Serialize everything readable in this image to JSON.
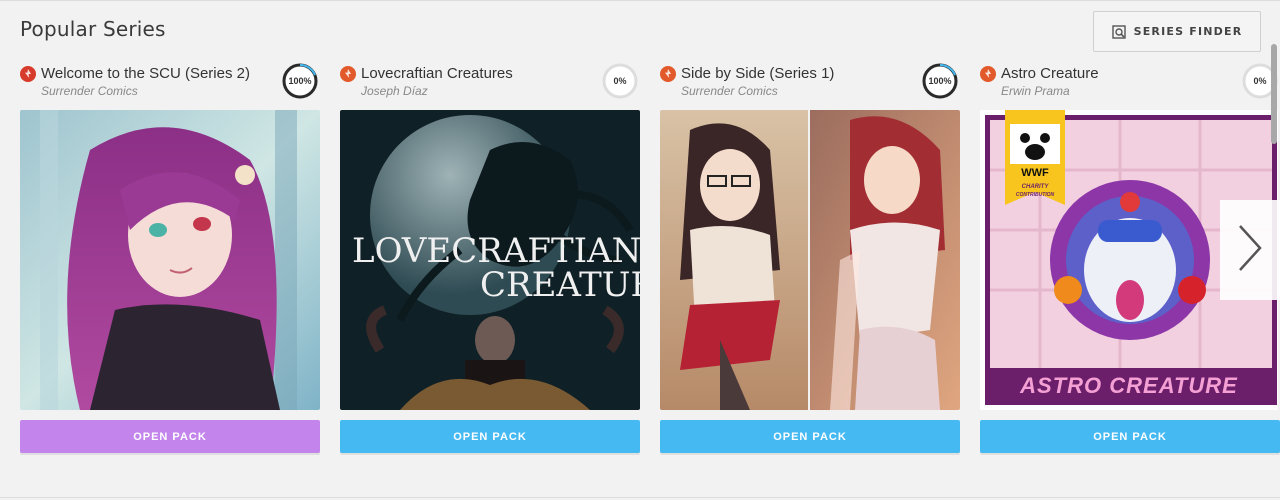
{
  "section": {
    "title": "Popular Series",
    "finder_label": "SERIES FINDER"
  },
  "cards": [
    {
      "name": "Welcome to the SCU (Series 2)",
      "author": "Surrender Comics",
      "progress_text": "100%",
      "progress": 1.0,
      "icon_color": "#d63b2b",
      "cover_text_1": "",
      "cover_text_2": "",
      "button_label": "OPEN PACK",
      "button_color": "#c384ec"
    },
    {
      "name": "Lovecraftian Creatures",
      "author": "Joseph Díaz",
      "progress_text": "0%",
      "progress": 0.0,
      "icon_color": "#e2592b",
      "cover_text_1": "LOVECRAFTIAN",
      "cover_text_2": "CREATURES",
      "button_label": "OPEN PACK",
      "button_color": "#45b9f2"
    },
    {
      "name": "Side by Side (Series 1)",
      "author": "Surrender Comics",
      "progress_text": "100%",
      "progress": 1.0,
      "icon_color": "#e2592b",
      "cover_text_1": "",
      "cover_text_2": "",
      "button_label": "OPEN PACK",
      "button_color": "#45b9f2"
    },
    {
      "name": "Astro Creature",
      "author": "Erwin Prama",
      "progress_text": "0%",
      "progress": 0.0,
      "icon_color": "#e2592b",
      "cover_text_1": "ASTRO CREATURE",
      "cover_text_2": "",
      "badge_main": "WWF",
      "badge_sub_1": "CHARITY",
      "badge_sub_2": "CONTRIBUTION",
      "button_label": "OPEN PACK",
      "button_color": "#45b9f2"
    }
  ],
  "icons": {
    "finder": "search-list-icon",
    "next": "chevron-right-icon",
    "brand": "flame-badge-icon"
  },
  "colors": {
    "progress_ring": "#2a2a2a",
    "progress_track": "#dddddd",
    "progress_accent": "#45b9f2"
  }
}
